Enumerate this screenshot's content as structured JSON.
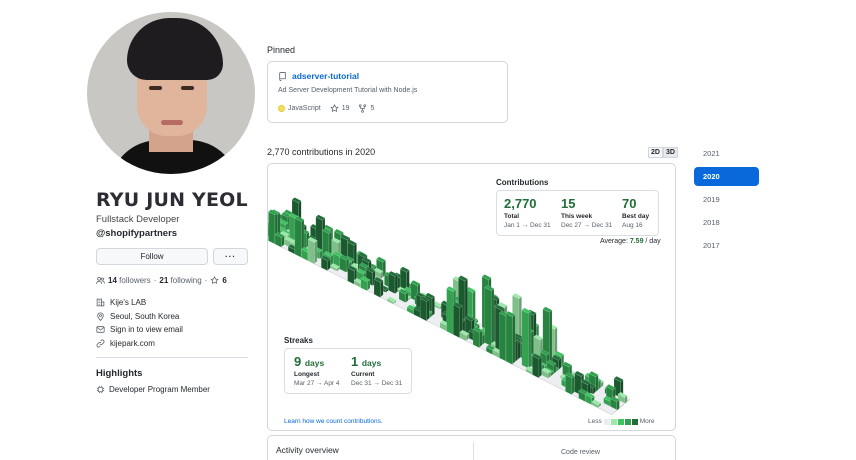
{
  "profile": {
    "name": "RYU JUN YEOL",
    "role": "Fullstack Developer",
    "handle": "@shopifypartners",
    "follow_label": "Follow",
    "more_label": "···",
    "followers_count": "14",
    "followers_label": "followers",
    "following_count": "21",
    "following_label": "following",
    "stars_count": "6",
    "company": "Kije's LAB",
    "location": "Seoul, South Korea",
    "email": "Sign in to view email",
    "website": "kijepark.com"
  },
  "highlights": {
    "title": "Highlights",
    "item": "Developer Program Member"
  },
  "pinned": {
    "title": "Pinned",
    "repo_name": "adserver-tutorial",
    "description": "Ad Server Development Tutorial with Node.js",
    "language": "JavaScript",
    "language_color": "#f1e05a",
    "stars": "19",
    "forks": "5"
  },
  "contributions": {
    "title": "2,770 contributions in 2020",
    "toggle_2d": "2D",
    "toggle_3d": "3D",
    "stats_title": "Contributions",
    "total_value": "2,770",
    "total_label": "Total",
    "total_range": "Jan 1 → Dec 31",
    "week_value": "15",
    "week_label": "This week",
    "week_range": "Dec 27 → Dec 31",
    "best_value": "70",
    "best_label": "Best day",
    "best_date": "Aug 16",
    "average_label": "Average:",
    "average_value": "7.59",
    "average_unit": "/ day",
    "streaks_title": "Streaks",
    "longest_value": "9",
    "longest_unit": "days",
    "longest_label": "Longest",
    "longest_range": "Mar 27 → Apr 4",
    "current_value": "1",
    "current_unit": "days",
    "current_label": "Current",
    "current_range": "Dec 31 → Dec 31",
    "learn_link": "Learn how we count contributions.",
    "legend_less": "Less",
    "legend_more": "More",
    "legend_colors": [
      "#ebedf0",
      "#9be9a8",
      "#40c463",
      "#30a14e",
      "#216e39"
    ]
  },
  "years": [
    "2021",
    "2020",
    "2019",
    "2018",
    "2017"
  ],
  "active_year": "2020",
  "activity": {
    "title": "Activity overview",
    "code_review": "Code review"
  },
  "colors": {
    "accent": "#0969da",
    "green_dark": "#216e39"
  }
}
